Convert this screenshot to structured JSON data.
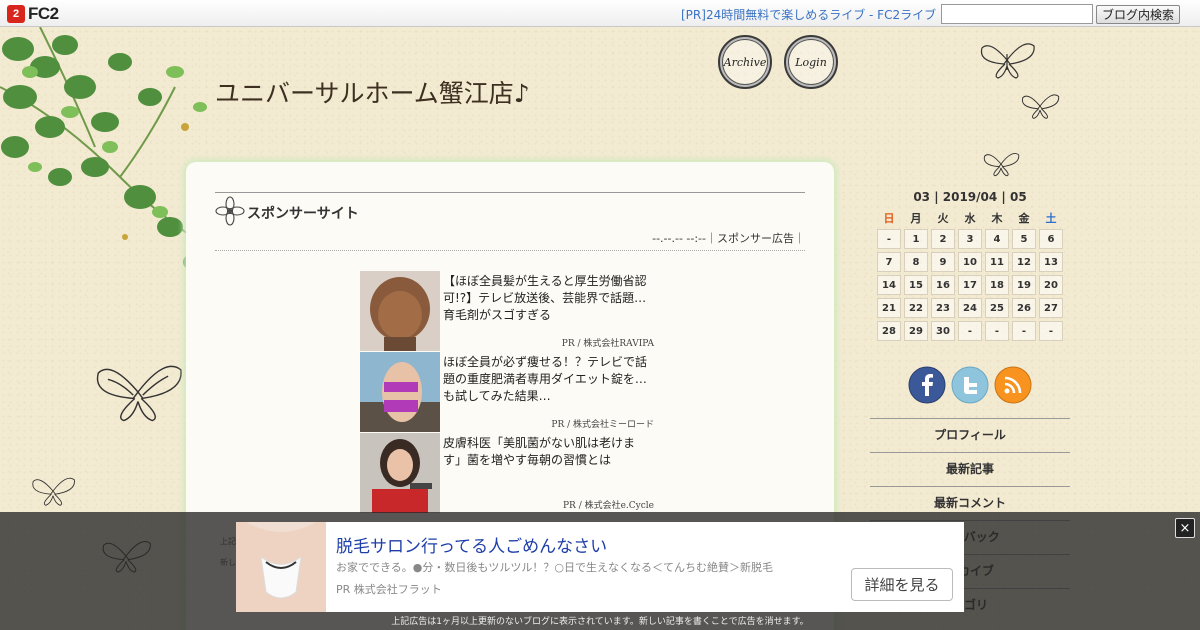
{
  "fc2bar": {
    "logo_text": "FC2",
    "logo_mark": "2",
    "pr_link": "[PR]24時間無料で楽しめるライブ - FC2ライブ",
    "search_button": "ブログ内検索",
    "search_value": ""
  },
  "header": {
    "title": "ユニバーサルホーム蟹江店♪",
    "archive_label": "Archive",
    "login_label": "Login"
  },
  "entry": {
    "title": "スポンサーサイト",
    "meta": "--.--.-- --:--｜スポンサー広告｜",
    "ads": [
      {
        "text": "【ほぼ全員髪が生えると厚生労働省認可!?】テレビ放送後、芸能界で話題…育毛剤がスゴすぎる",
        "pr": "PR / 株式会社RAVIPA"
      },
      {
        "text": "ほぼ全員が必ず痩せる！？テレビで話題の重度肥満者専用ダイエット錠を…も試してみた結果…",
        "pr": "PR / 株式会社ミーロード"
      },
      {
        "text": "皮膚科医「美肌菌がない肌は老けます」菌を増やす毎朝の習慣とは",
        "pr": "PR / 株式会社e.Cycle"
      }
    ],
    "note_1": "上記",
    "note_2": "新し"
  },
  "calendar": {
    "title": "03 | 2019/04 | 05",
    "weekdays": [
      "日",
      "月",
      "火",
      "水",
      "木",
      "金",
      "土"
    ],
    "weeks": [
      [
        "-",
        "1",
        "2",
        "3",
        "4",
        "5",
        "6"
      ],
      [
        "7",
        "8",
        "9",
        "10",
        "11",
        "12",
        "13"
      ],
      [
        "14",
        "15",
        "16",
        "17",
        "18",
        "19",
        "20"
      ],
      [
        "21",
        "22",
        "23",
        "24",
        "25",
        "26",
        "27"
      ],
      [
        "28",
        "29",
        "30",
        "-",
        "-",
        "-",
        "-"
      ]
    ]
  },
  "colors": {
    "sunday": "#e05a1a",
    "saturday": "#2c6fd0",
    "facebook": "#3b5998",
    "twitter": "#55acee",
    "rss": "#f7931e"
  },
  "social": [
    "facebook-icon",
    "twitter-icon",
    "rss-icon"
  ],
  "sidebar": {
    "menu": [
      "プロフィール",
      "最新記事",
      "最新コメント",
      "ックバック",
      "ーカイブ",
      "テゴリ"
    ]
  },
  "overlay": {
    "title": "脱毛サロン行ってる人ごめんなさい",
    "desc": "お家でできる。●分・数日後もツルツル！？○日で生えなくなる＜てんちむ絶賛＞新脱毛",
    "pr": "PR  株式会社フラット",
    "button": "詳細を見る",
    "close": "×",
    "footnote": "上記広告は1ヶ月以上更新のないブログに表示されています。新しい記事を書くことで広告を消せます。"
  }
}
